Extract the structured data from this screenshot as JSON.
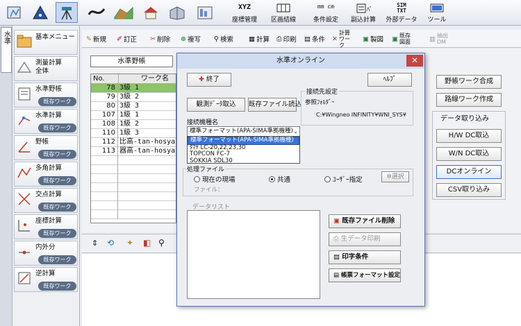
{
  "ribbon": {
    "buttons": [
      {
        "label": "座標管理",
        "icon": "xyz-icon"
      },
      {
        "label": "区画結線",
        "icon": "parcel-icon"
      },
      {
        "label": "条件設定",
        "icon": "units-icon"
      },
      {
        "label": "副込計算",
        "icon": "calc-icon"
      },
      {
        "label": "外部データ",
        "icon": "sim-txt-icon"
      },
      {
        "label": "ツール",
        "icon": "tool-icon"
      }
    ],
    "xyz_text": "XYZ",
    "units_text": "mm cm",
    "sim_text": "SIM TXT"
  },
  "vertical_tab": "水準",
  "sidebar": {
    "items": [
      {
        "label": "基本メニュー",
        "label2": "",
        "badge": ""
      },
      {
        "label": "測量計算",
        "label2": "全体",
        "badge": ""
      },
      {
        "label": "水準野帳",
        "label2": "",
        "badge": "既存ワーク"
      },
      {
        "label": "水準計算",
        "label2": "",
        "badge": "既存ワーク"
      },
      {
        "label": "野帳",
        "label2": "",
        "badge": "既存ワーク"
      },
      {
        "label": "多角計算",
        "label2": "",
        "badge": "既存ワーク"
      },
      {
        "label": "交点計算",
        "label2": "",
        "badge": "既存ワーク"
      },
      {
        "label": "座標計算",
        "label2": "",
        "badge": "既存ワーク"
      },
      {
        "label": "内外分",
        "label2": "",
        "badge": "既存ワーク"
      },
      {
        "label": "逆計算",
        "label2": "",
        "badge": "既存ワーク"
      }
    ]
  },
  "toolbar": {
    "new": "新規",
    "edit": "訂正",
    "delete": "削除",
    "copy": "複写",
    "search": "検索",
    "calc": "計算",
    "print": "印刷",
    "condition": "条件",
    "calc_work": "計算ワーク",
    "drafting": "製図",
    "existing_drawing": "既存図面",
    "export": "抽出DM"
  },
  "main": {
    "title": "水準野帳",
    "columns": [
      "No.",
      "ワーク名"
    ],
    "rows": [
      {
        "no": "78",
        "name": "3級 1"
      },
      {
        "no": "79",
        "name": "3級 2"
      },
      {
        "no": "80",
        "name": "3級 3"
      },
      {
        "no": "107",
        "name": "1級 1"
      },
      {
        "no": "108",
        "name": "1級 2"
      },
      {
        "no": "110",
        "name": "1級 3"
      },
      {
        "no": "112",
        "name": "比高-tan-hosya"
      },
      {
        "no": "113",
        "name": "器高-tan-hosya"
      }
    ]
  },
  "right_panel": {
    "work_merge": "野帳ワーク合成",
    "route_work": "路線ワーク作成",
    "import_title": "データ取り込み",
    "hw_dc": "H/W DC取込",
    "wn_dc": "W/N DC取込",
    "dc_online": "DCオンライン",
    "csv": "CSV取り込み"
  },
  "dialog": {
    "title": "水準オンライン",
    "end": "終了",
    "help": "ﾍﾙﾌﾟ",
    "observe_load": "観測ﾃﾞｰﾀ取込",
    "existing_load": "既存ファイル読込",
    "conn_title": "接続先設定",
    "ref_folder": "参照ﾌｫﾙﾀﾞｰ",
    "ref_path": "C:¥Wingneo INFINITY¥WNI_SYS¥",
    "model_label": "接続機種名",
    "model_selected": "標準フォーマット(APA-SIMA準拠機種)",
    "model_options": [
      "標準フォーマット(APA-SIMA準拠機種)",
      "ﾀﾏﾔ LC-20,22,23,30",
      "TOPCON FC-7",
      "SOKKIA SDL30"
    ],
    "proc_title": "処理ファイル",
    "radio_site": "現在の現場",
    "radio_common": "共通",
    "radio_user": "ﾕｰｻﾞｰ指定",
    "select": "選択",
    "file_label": "ファイル：",
    "data_list": "データリスト",
    "delete_file": "既存ファイル削除",
    "raw_print": "生データ印刷",
    "print_cond": "印字条件",
    "format_set": "帳票フォーマット設定"
  }
}
